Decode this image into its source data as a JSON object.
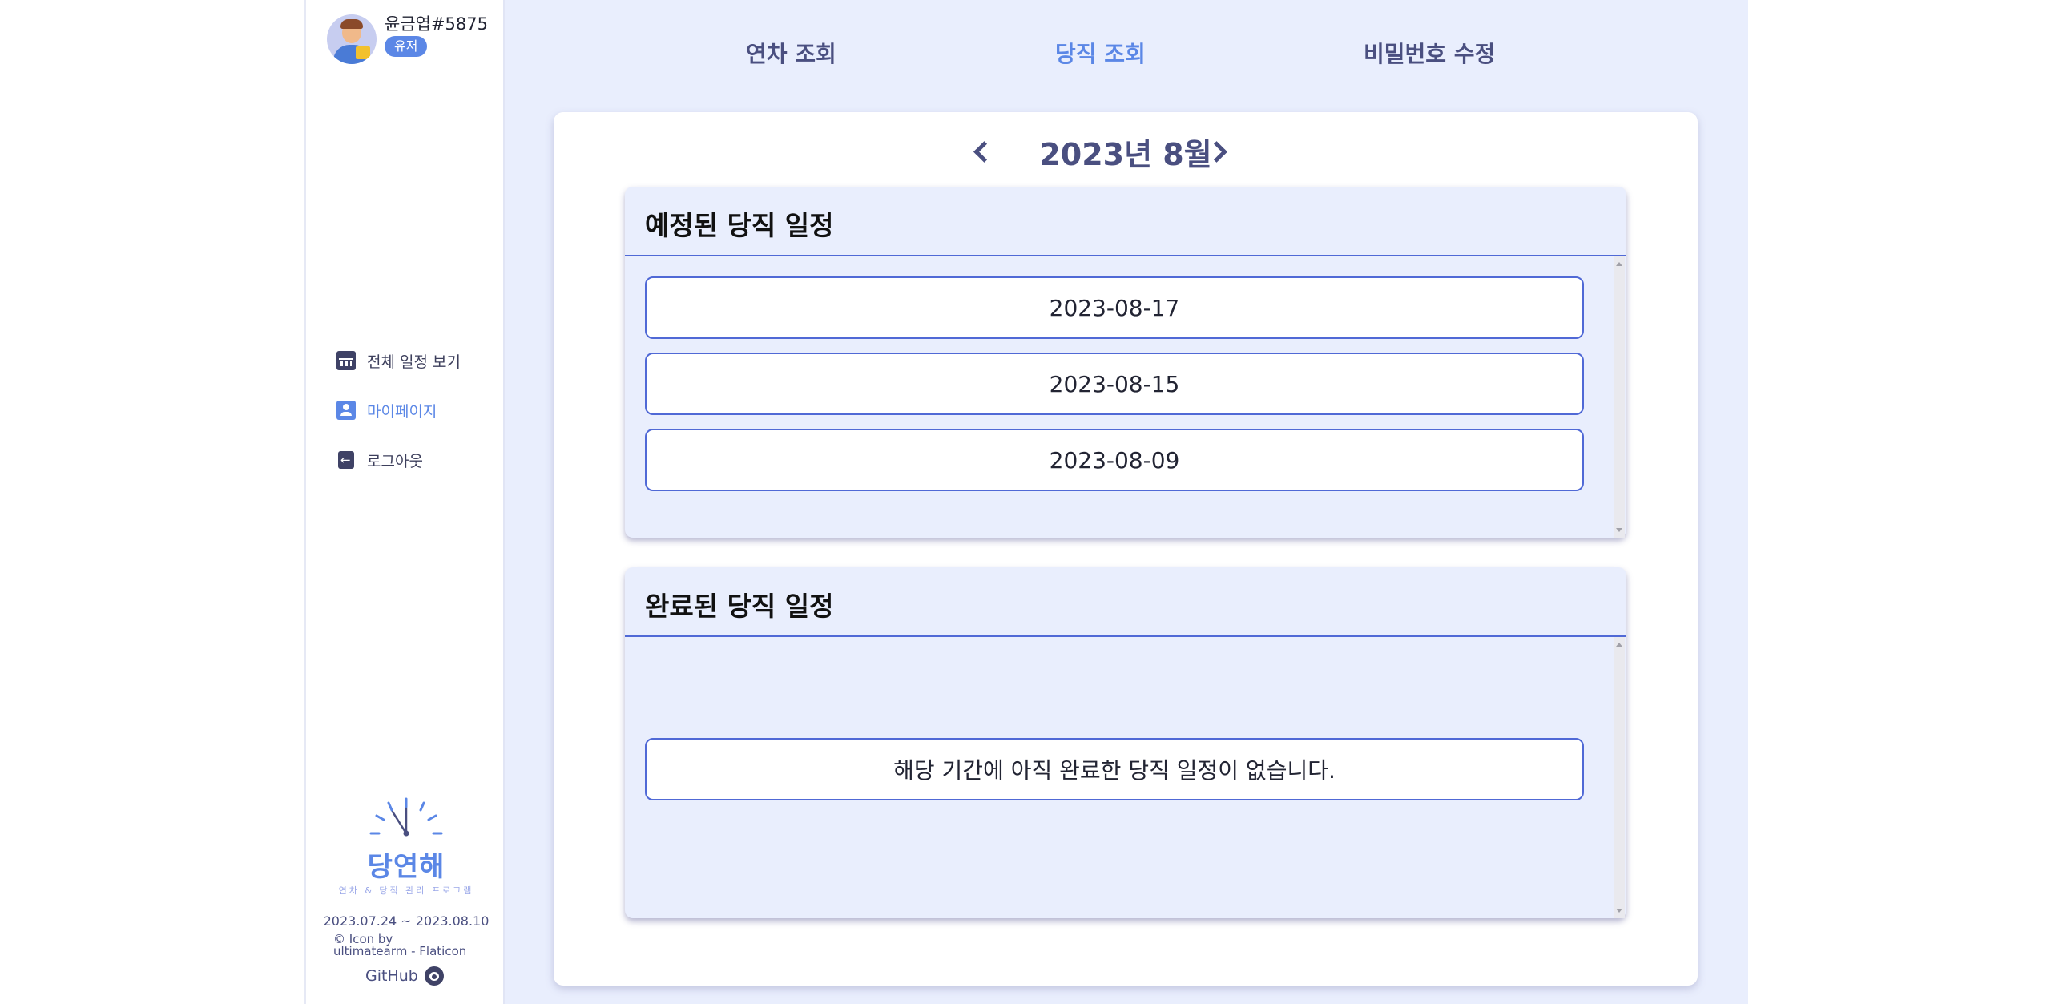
{
  "user": {
    "name": "윤금엽#5875",
    "role": "유저"
  },
  "sidebar": {
    "items": [
      {
        "label": "전체 일정 보기",
        "icon": "calendar-icon"
      },
      {
        "label": "마이페이지",
        "icon": "user-profile-icon"
      },
      {
        "label": "로그아웃",
        "icon": "logout-icon"
      }
    ],
    "logo_title": "당연해",
    "logo_sub": "연차 & 당직 관리 프로그램",
    "period": "2023.07.24 ~ 2023.08.10",
    "credit_line1": "© Icon by",
    "credit_line2": "ultimatearm - Flaticon",
    "github": "GitHub"
  },
  "tabs": [
    {
      "label": "연차 조회"
    },
    {
      "label": "당직 조회"
    },
    {
      "label": "비밀번호 수정"
    }
  ],
  "month": {
    "title": "2023년 8월"
  },
  "upcoming": {
    "title": "예정된 당직 일정",
    "dates": [
      "2023-08-17",
      "2023-08-15",
      "2023-08-09"
    ]
  },
  "completed": {
    "title": "완료된 당직 일정",
    "empty_message": "해당 기간에 아직 완료한 당직 일정이 없습니다."
  },
  "colors": {
    "accent": "#5b87e6",
    "text": "#4a4f80",
    "main_bg": "#e9eefd",
    "border": "#5069d6"
  }
}
